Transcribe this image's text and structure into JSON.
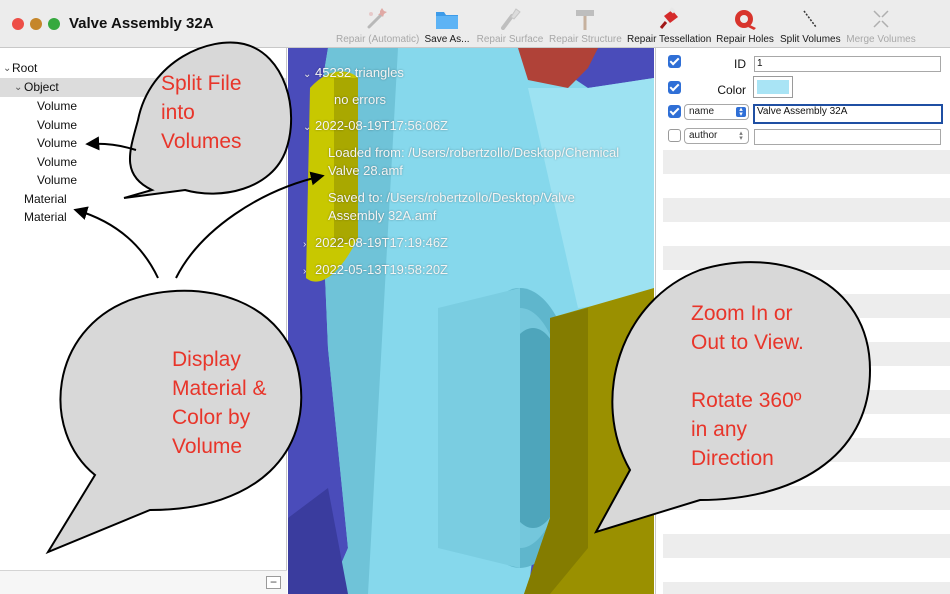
{
  "window": {
    "title": "Valve Assembly 32A"
  },
  "toolbar": {
    "items": [
      {
        "label": "Repair (Automatic)",
        "icon": "wand-wrench-icon",
        "enabled": false
      },
      {
        "label": "Save As...",
        "icon": "folder-icon",
        "enabled": true
      },
      {
        "label": "Repair Surface",
        "icon": "brush-icon",
        "enabled": false
      },
      {
        "label": "Repair Structure",
        "icon": "hammer-icon",
        "enabled": false
      },
      {
        "label": "Repair Tessellation",
        "icon": "glue-bottle-icon",
        "enabled": true
      },
      {
        "label": "Repair Holes",
        "icon": "tape-roll-icon",
        "enabled": true
      },
      {
        "label": "Split Volumes",
        "icon": "split-line-icon",
        "enabled": true
      },
      {
        "label": "Merge Volumes",
        "icon": "merge-arrows-icon",
        "enabled": false
      }
    ]
  },
  "outline": {
    "items": [
      {
        "label": "Root",
        "level": 0,
        "disclosure": "open"
      },
      {
        "label": "Object",
        "level": 1,
        "disclosure": "open",
        "selected": true
      },
      {
        "label": "Volume",
        "level": 2
      },
      {
        "label": "Volume",
        "level": 2
      },
      {
        "label": "Volume",
        "level": 2
      },
      {
        "label": "Volume",
        "level": 2
      },
      {
        "label": "Volume",
        "level": 2
      },
      {
        "label": "Material",
        "level": 1
      },
      {
        "label": "Material",
        "level": 1
      }
    ],
    "remove_button": "−"
  },
  "viewport": {
    "log": {
      "triangles": "45232 triangles",
      "errors": "no errors",
      "entry1_date": "2022-08-19T17:56:06Z",
      "loaded_from_line1": "Loaded from: /Users/robertzollo/Desktop/Chemical",
      "loaded_from_line2": "Valve 28.amf",
      "saved_to_line1": "Saved to: /Users/robertzollo/Desktop/Valve",
      "saved_to_line2": "Assembly 32A.amf",
      "entry2_date": "2022-08-19T17:19:46Z",
      "entry3_date": "2022-05-13T19:58:20Z"
    }
  },
  "inspector": {
    "id_label": "ID",
    "id_value": "1",
    "color_label": "Color",
    "color_value": "#a9e4f5",
    "meta1_key": "name",
    "meta1_value": "Valve Assembly 32A",
    "meta2_key": "author",
    "meta2_value": ""
  },
  "callouts": {
    "split": [
      "Split File",
      "into",
      "Volumes"
    ],
    "display": [
      "Display",
      "Material &",
      "Color by",
      "Volume"
    ],
    "zoom": [
      "Zoom In or",
      "Out to View.",
      "",
      "Rotate 360º",
      "in any",
      "Direction"
    ]
  },
  "colors": {
    "callout_text": "#e8352a",
    "callout_fill": "#d8d8d8",
    "viewport_bg": "#4a4cba",
    "part_cyan": "#86d8ec",
    "part_yellow": "#9a9000",
    "part_red": "#b04238",
    "selection_blue": "#2f6fd6"
  }
}
